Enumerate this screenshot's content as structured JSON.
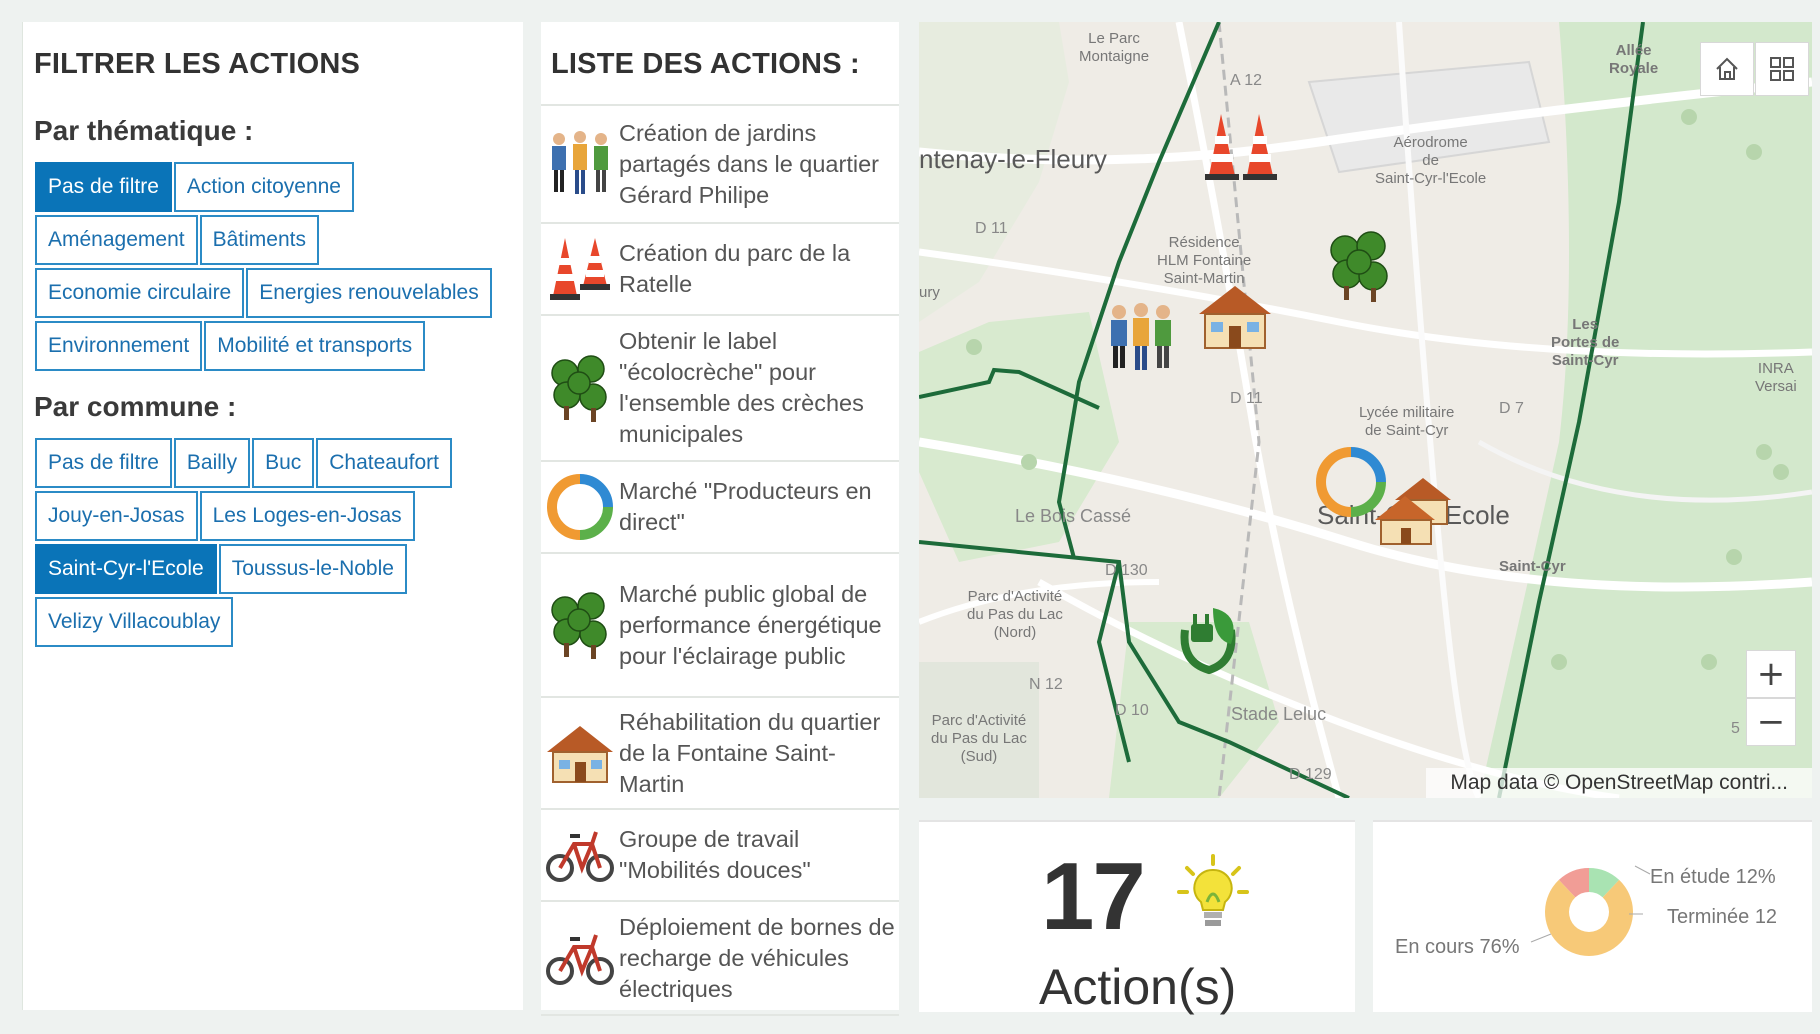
{
  "filter": {
    "title": "FILTRER LES ACTIONS",
    "thematique_label": "Par thématique :",
    "thematique_rows": [
      [
        {
          "label": "Pas de filtre",
          "active": true
        },
        {
          "label": "Action citoyenne",
          "active": false
        }
      ],
      [
        {
          "label": "Aménagement",
          "active": false
        },
        {
          "label": "Bâtiments",
          "active": false
        }
      ],
      [
        {
          "label": "Economie circulaire",
          "active": false
        },
        {
          "label": "Energies renouvelables",
          "active": false
        }
      ],
      [
        {
          "label": "Environnement",
          "active": false
        },
        {
          "label": "Mobilité et transports",
          "active": false
        }
      ]
    ],
    "commune_label": "Par commune :",
    "commune_rows": [
      [
        {
          "label": "Pas de filtre",
          "active": false
        },
        {
          "label": "Bailly",
          "active": false
        },
        {
          "label": "Buc",
          "active": false
        },
        {
          "label": "Chateaufort",
          "active": false
        }
      ],
      [
        {
          "label": "Jouy-en-Josas",
          "active": false
        },
        {
          "label": "Les Loges-en-Josas",
          "active": false
        }
      ],
      [
        {
          "label": "Saint-Cyr-l'Ecole",
          "active": true
        },
        {
          "label": "Toussus-le-Noble",
          "active": false
        }
      ],
      [
        {
          "label": "Velizy Villacoublay",
          "active": false
        }
      ]
    ]
  },
  "list": {
    "title": "LISTE DES ACTIONS :",
    "items": [
      {
        "icon": "people-icon",
        "text": "Création de jardins partagés dans le quartier Gérard Philipe"
      },
      {
        "icon": "traffic-cone-icon",
        "text": "Création du parc de la Ratelle"
      },
      {
        "icon": "trees-icon",
        "text": "Obtenir le label \"écolocrèche\" pour l'ensemble des crèches municipales"
      },
      {
        "icon": "recycle-icon",
        "text": "Marché \"Producteurs en direct\""
      },
      {
        "icon": "trees-icon",
        "text": "Marché public global de performance énergétique pour l'éclairage public"
      },
      {
        "icon": "house-icon",
        "text": "Réhabilitation du quartier de la Fontaine Saint-Martin"
      },
      {
        "icon": "bicycle-icon",
        "text": "Groupe de travail \"Mobilités douces\""
      },
      {
        "icon": "bicycle-icon",
        "text": "Déploiement de bornes de recharge de véhicules électriques"
      }
    ]
  },
  "map": {
    "labels": {
      "le_parc": "Le Parc\nMontaigne",
      "fontenay": "ntenay-le-Fleury",
      "d11_a": "D 11",
      "d11_b": "D 11",
      "a12": "A 12",
      "n12": "N 12",
      "d10": "D 10",
      "d129": "D 129",
      "d7": "D 7",
      "d130": "D 130",
      "aerodrome": "Aérodrome\nde\nSaint-Cyr-l'Ecole",
      "allee_royale": "Allée\nRoyale",
      "residence": "Résidence\nHLM Fontaine\nSaint-Martin",
      "portes": "Les\nPortes de\nSaint-Cyr",
      "inra": "INRA\nVersai",
      "lycee": "Lycée militaire\nde Saint-Cyr",
      "bois_casse": "Le Bois Cassé",
      "saint_ecole": "Saint-Cyr-l'Ecole",
      "saint_cyr": "Saint-Cyr",
      "parc_nord": "Parc d'Activité\ndu Pas du Lac\n(Nord)",
      "parc_sud": "Parc d'Activité\ndu Pas du Lac\n(Sud)",
      "stade": "Stade Leluc",
      "bailly": "ury",
      "pa": "Pa",
      "le": "le",
      "five": "5"
    },
    "attribution": "Map data © OpenStreetMap contri...",
    "zoom_in": "+",
    "zoom_out": "−"
  },
  "count": {
    "value": "17",
    "label": "Action(s)"
  },
  "donut": {
    "chart_data": {
      "type": "pie",
      "categories": [
        "En cours",
        "En étude",
        "Terminée"
      ],
      "values": [
        76,
        12,
        12
      ],
      "colors": [
        "#f7c978",
        "#f19d96",
        "#a9e3b2"
      ]
    },
    "labels": {
      "en_cours": "En cours 76%",
      "en_etude": "En étude 12%",
      "terminee": "Terminée 12"
    }
  },
  "colors": {
    "accent": "#0a74b8",
    "border_line": "#1d6b3a"
  }
}
